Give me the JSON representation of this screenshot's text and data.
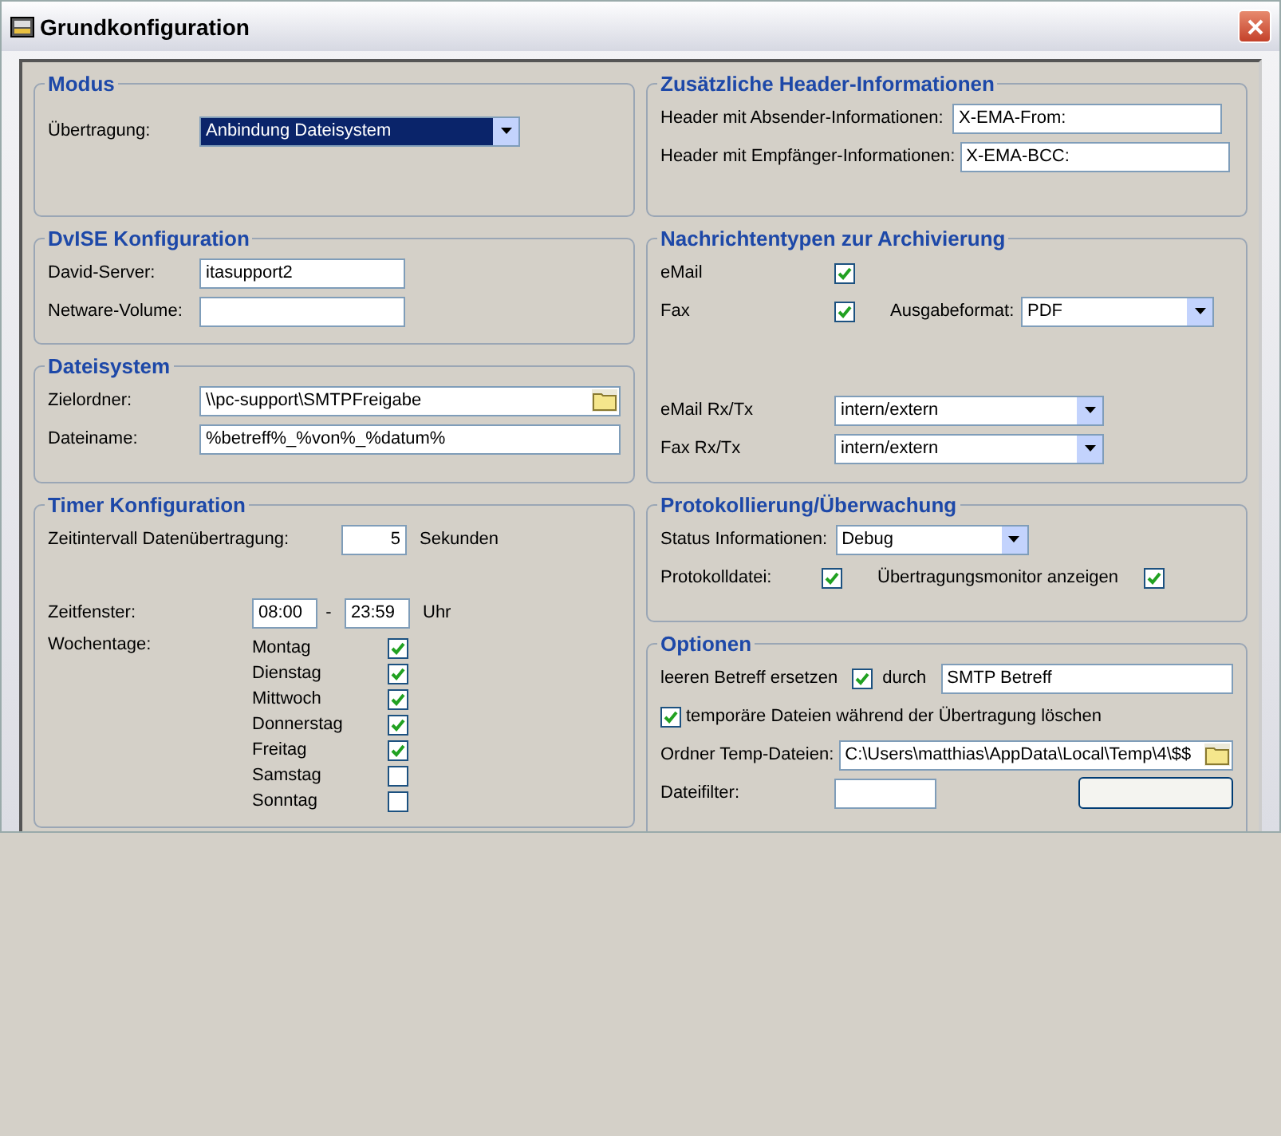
{
  "window": {
    "title": "Grundkonfiguration"
  },
  "modus": {
    "title": "Modus",
    "label": "Übertragung:",
    "value": "Anbindung Dateisystem"
  },
  "dvise": {
    "title": "DvISE Konfiguration",
    "fields": [
      {
        "label": "David-Server:",
        "value": "itasupport2"
      },
      {
        "label": "Netware-Volume:"
      }
    ]
  },
  "dateisystem": {
    "title": "Dateisystem",
    "fields": [
      {
        "label": "Zielordner:",
        "value": "\\\\pc-support\\SMTPFreigabe",
        "kind": "folder"
      },
      {
        "label": "Dateiname:",
        "value": "%betreff%_%von%_%datum%",
        "kind": "text"
      }
    ]
  },
  "timer": {
    "title": "Timer Konfiguration",
    "interval": {
      "label": "Zeitintervall Datenübertragung:",
      "value": "5",
      "unit": "Sekunden"
    },
    "timespan": {
      "label": "Zeitfenster:",
      "from": "08:00",
      "separator": "-",
      "to": "23:59",
      "unit": "Uhr"
    },
    "weekdays": {
      "label": "Wochentage:",
      "days": [
        {
          "name": "Montag",
          "checked": true
        },
        {
          "name": "Dienstag",
          "checked": true
        },
        {
          "name": "Mittwoch",
          "checked": true
        },
        {
          "name": "Donnerstag",
          "checked": true
        },
        {
          "name": "Freitag",
          "checked": true
        },
        {
          "name": "Samstag",
          "checked": false
        },
        {
          "name": "Sonntag",
          "checked": false
        }
      ]
    }
  },
  "header": {
    "title": "Zusätzliche Header-Informationen",
    "fields": [
      {
        "label": "Header mit Absender-Informationen:",
        "value": "X-EMA-From:"
      },
      {
        "label": "Header mit Empfänger-Informationen:",
        "value": "X-EMA-BCC:"
      }
    ]
  },
  "nachrichten": {
    "title": "Nachrichtentypen zur Archivierung",
    "email": {
      "label": "eMail",
      "checked": true
    },
    "fax": {
      "label": "Fax",
      "checked": true
    },
    "format": {
      "label": "Ausgabeformat:",
      "value": "PDF"
    },
    "rxtx": [
      {
        "label": "eMail Rx/Tx",
        "value": "intern/extern"
      },
      {
        "label": "Fax Rx/Tx",
        "value": "intern/extern"
      }
    ]
  },
  "protokoll": {
    "title": "Protokollierung/Überwachung",
    "status": {
      "label": "Status Informationen:",
      "value": "Debug"
    },
    "logfile": {
      "label": "Protokolldatei:",
      "checked": true
    },
    "monitor": {
      "label": "Übertragungsmonitor anzeigen",
      "checked": true
    }
  },
  "optionen": {
    "title": "Optionen",
    "replace": {
      "label": "leeren Betreff ersetzen",
      "checked": true,
      "by": "durch",
      "value": "SMTP Betreff"
    },
    "delete_temp": {
      "label": "temporäre Dateien während der Übertragung löschen",
      "checked": true
    },
    "temp_folder": {
      "label": "Ordner Temp-Dateien:",
      "value": "C:\\Users\\matthias\\AppData\\Local\\Temp\\4\\$$"
    },
    "filter": {
      "label": "Dateifilter:"
    }
  }
}
